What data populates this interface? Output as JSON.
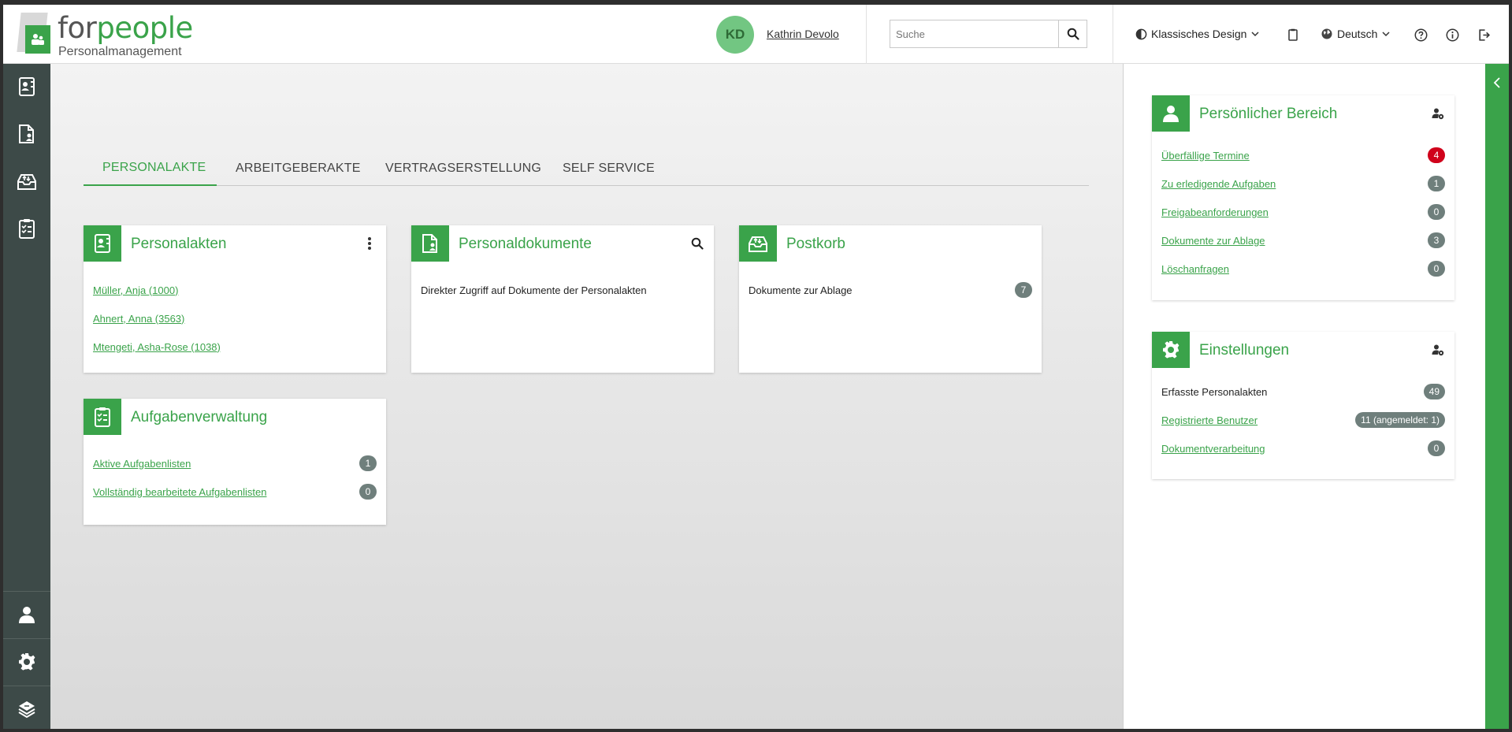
{
  "header": {
    "logo": {
      "word_part1": "for",
      "word_part2": "people",
      "subtitle": "Personalmanagement"
    },
    "user": {
      "initials": "KD",
      "name": "Kathrin Devolo"
    },
    "search": {
      "placeholder": "Suche"
    },
    "design_label": "Klassisches Design",
    "language_label": "Deutsch"
  },
  "tabs": [
    {
      "label": "PERSONALAKTE"
    },
    {
      "label": "ARBEITGEBERAKTE"
    },
    {
      "label": "VERTRAGSERSTELLUNG"
    },
    {
      "label": "SELF SERVICE"
    }
  ],
  "cards": {
    "personalakten": {
      "title": "Personalakten",
      "items": [
        "Müller, Anja (1000)",
        "Ahnert, Anna (3563)",
        "Mtengeti, Asha-Rose (1038)"
      ]
    },
    "personaldokumente": {
      "title": "Personaldokumente",
      "text": "Direkter Zugriff auf Dokumente der Personalakten"
    },
    "postkorb": {
      "title": "Postkorb",
      "text": "Dokumente zur Ablage",
      "count": "7"
    },
    "aufgaben": {
      "title": "Aufgabenverwaltung",
      "items": [
        {
          "label": "Aktive Aufgabenlisten",
          "count": "1"
        },
        {
          "label": "Vollständig bearbeitete Aufgabenlisten",
          "count": "0"
        }
      ]
    }
  },
  "right": {
    "personal": {
      "title": "Persönlicher Bereich",
      "items": [
        {
          "label": "Überfällige Termine",
          "count": "4"
        },
        {
          "label": "Zu erledigende Aufgaben",
          "count": "1"
        },
        {
          "label": "Freigabeanforderungen",
          "count": "0"
        },
        {
          "label": "Dokumente zur Ablage",
          "count": "3"
        },
        {
          "label": "Löschanfragen",
          "count": "0"
        }
      ]
    },
    "settings": {
      "title": "Einstellungen",
      "items": [
        {
          "label": "Erfasste Personalakten",
          "count": "49"
        },
        {
          "label": "Registrierte Benutzer",
          "count": "11 (angemeldet: 1)"
        },
        {
          "label": "Dokumentverarbeitung",
          "count": "0"
        }
      ]
    }
  },
  "colors": {
    "accent": "#3aa34a",
    "sidebar": "#3d4a48",
    "badge": "#6f7f7c",
    "badge_alert": "#d0021b"
  }
}
